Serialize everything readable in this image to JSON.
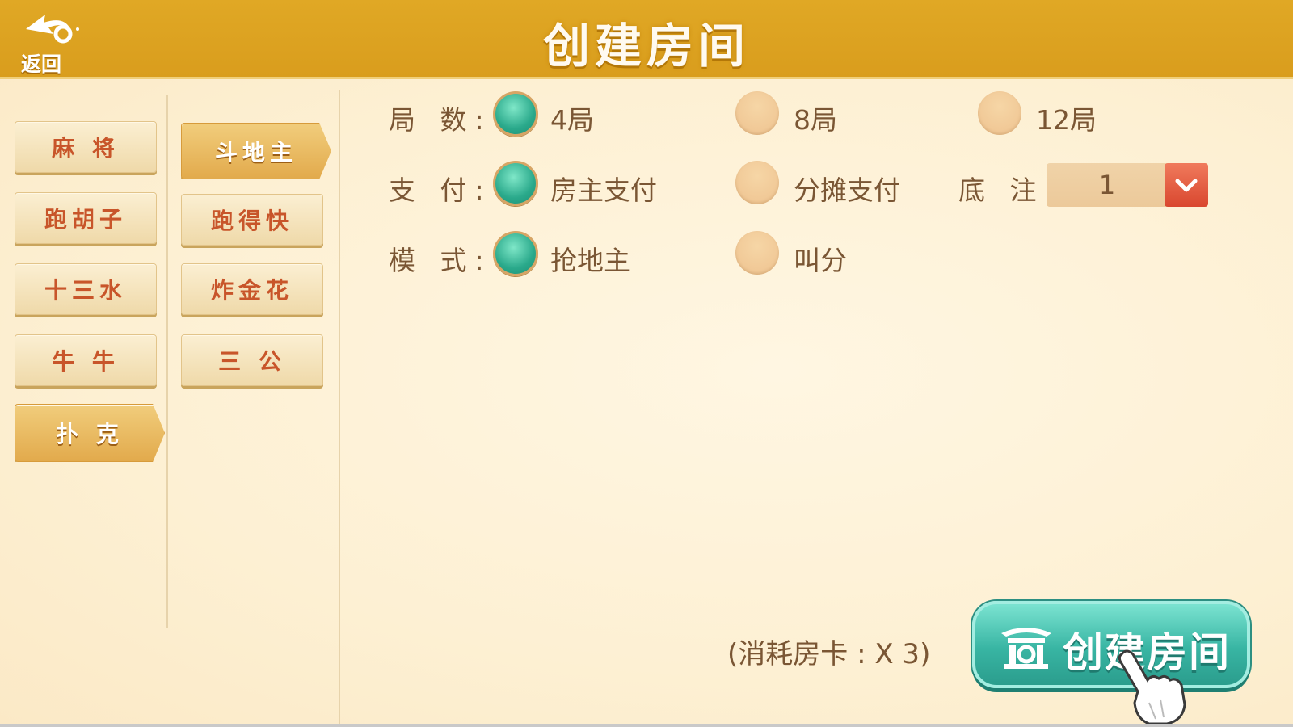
{
  "header": {
    "title": "创建房间",
    "back_label": "返回"
  },
  "sidebar": {
    "categories": [
      {
        "label": "麻 将",
        "active": false
      },
      {
        "label": "跑胡子",
        "active": false
      },
      {
        "label": "十三水",
        "active": false
      },
      {
        "label": "牛 牛",
        "active": false
      },
      {
        "label": "扑 克",
        "active": true
      }
    ],
    "games": [
      {
        "label": "斗地主",
        "active": true
      },
      {
        "label": "跑得快",
        "active": false
      },
      {
        "label": "炸金花",
        "active": false
      },
      {
        "label": "三 公",
        "active": false
      }
    ]
  },
  "options": {
    "rounds": {
      "label": "局 数:",
      "choices": [
        {
          "label": "4局",
          "checked": true
        },
        {
          "label": "8局",
          "checked": false
        },
        {
          "label": "12局",
          "checked": false
        }
      ]
    },
    "payment": {
      "label": "支 付:",
      "choices": [
        {
          "label": "房主支付",
          "checked": true
        },
        {
          "label": "分摊支付",
          "checked": false
        }
      ]
    },
    "base_bet": {
      "label": "底 注:",
      "value": "1"
    },
    "mode": {
      "label": "模 式:",
      "choices": [
        {
          "label": "抢地主",
          "checked": true
        },
        {
          "label": "叫分",
          "checked": false
        }
      ]
    }
  },
  "footer": {
    "cost_text": "(消耗房卡 : X 3)",
    "create_label": "创建房间"
  },
  "colors": {
    "header_bg": "#dca421",
    "accent_teal": "#38b5a3",
    "text_brown": "#7a5634",
    "category_text": "#c8552a"
  }
}
